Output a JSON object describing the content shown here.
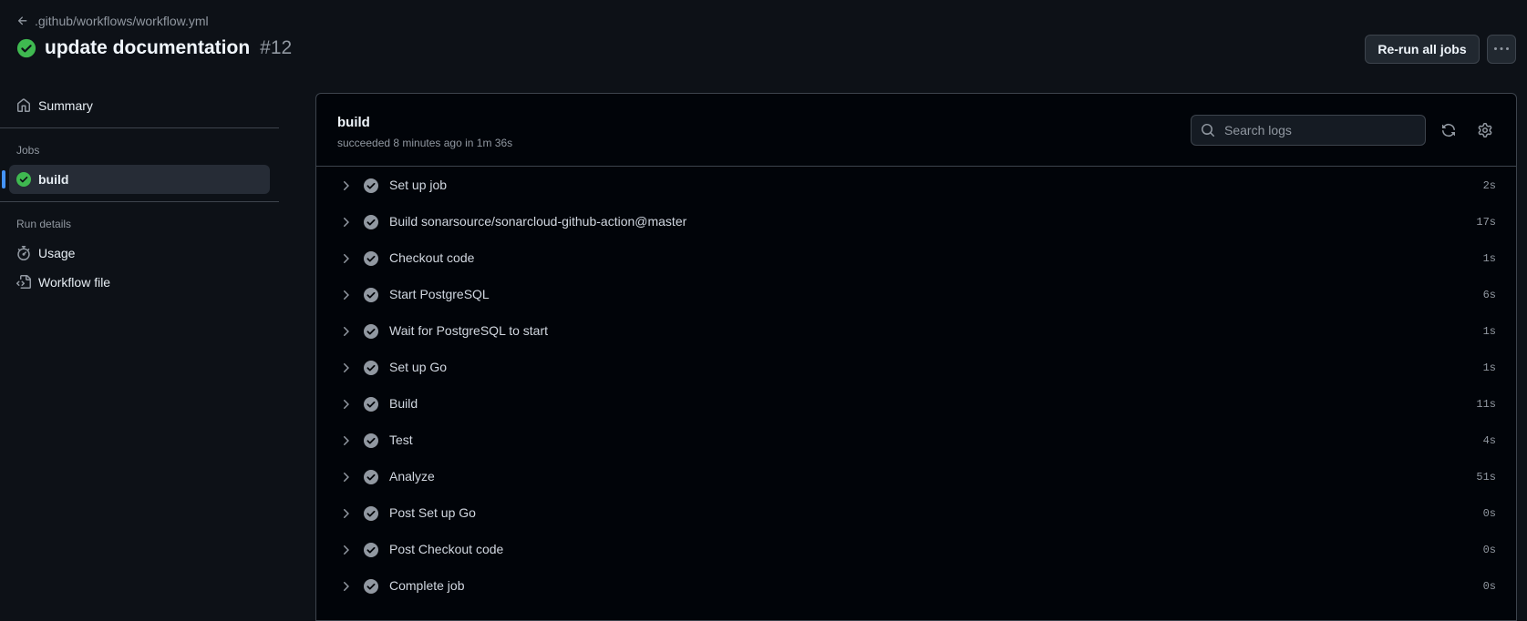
{
  "header": {
    "back_label": ".github/workflows/workflow.yml",
    "title": "update documentation",
    "run_number": "#12",
    "rerun_label": "Re-run all jobs"
  },
  "sidebar": {
    "summary_label": "Summary",
    "jobs_heading": "Jobs",
    "jobs": [
      {
        "label": "build"
      }
    ],
    "run_details_heading": "Run details",
    "details": [
      {
        "label": "Usage",
        "icon": "stopwatch-icon"
      },
      {
        "label": "Workflow file",
        "icon": "file-code-icon"
      }
    ]
  },
  "job": {
    "title": "build",
    "subtitle": "succeeded 8 minutes ago in 1m 36s",
    "search_placeholder": "Search logs"
  },
  "steps": [
    {
      "name": "Set up job",
      "time": "2s"
    },
    {
      "name": "Build sonarsource/sonarcloud-github-action@master",
      "time": "17s"
    },
    {
      "name": "Checkout code",
      "time": "1s"
    },
    {
      "name": "Start PostgreSQL",
      "time": "6s"
    },
    {
      "name": "Wait for PostgreSQL to start",
      "time": "1s"
    },
    {
      "name": "Set up Go",
      "time": "1s"
    },
    {
      "name": "Build",
      "time": "11s"
    },
    {
      "name": "Test",
      "time": "4s"
    },
    {
      "name": "Analyze",
      "time": "51s"
    },
    {
      "name": "Post Set up Go",
      "time": "0s"
    },
    {
      "name": "Post Checkout code",
      "time": "0s"
    },
    {
      "name": "Complete job",
      "time": "0s"
    }
  ],
  "colors": {
    "background": "#0d1117",
    "panel": "#010409",
    "success": "#3fb950",
    "accent": "#4493f8",
    "muted": "#9198a1"
  }
}
